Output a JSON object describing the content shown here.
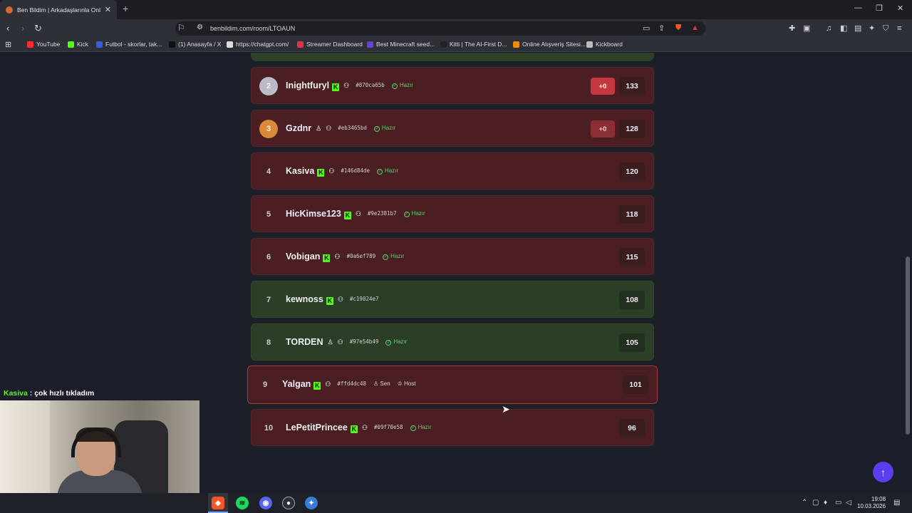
{
  "browser": {
    "tab_title": "Ben Bildim | Arkadaşlarınla Online",
    "tab_close": "✕",
    "new_tab": "+",
    "url": "benbildim.com/room/LTOAUN",
    "window_controls": [
      "—",
      "❐",
      "✕"
    ]
  },
  "bookmarks": [
    {
      "label": "YouTube",
      "color": "#ff2d2d"
    },
    {
      "label": "Kick",
      "color": "#53fc18"
    },
    {
      "label": "Futbol - skorlar, tak...",
      "color": "#3b5bdb"
    },
    {
      "label": "(1) Anasayfa / X",
      "color": "#111111"
    },
    {
      "label": "https://chatgpt.com/",
      "color": "#dddddd"
    },
    {
      "label": "Streamer Dashboard",
      "color": "#e0314b"
    },
    {
      "label": "Best Minecraft seed...",
      "color": "#6b3fd6"
    },
    {
      "label": "Kitti | The AI-First D...",
      "color": "#222222"
    },
    {
      "label": "Online Alışveriş Sitesi...",
      "color": "#f08c00"
    },
    {
      "label": "Kickboard",
      "color": "#bbbbbb"
    }
  ],
  "leaderboard": {
    "ready_label": "Hazır",
    "you_label": "Sen",
    "host_label": "Host",
    "players": [
      {
        "rank": "2",
        "name": "Inightfuryl",
        "kick": true,
        "id": "#870ca65b",
        "ready": true,
        "delta": "+0",
        "score": "133",
        "row": "red"
      },
      {
        "rank": "3",
        "name": "Gzdnr",
        "kick": false,
        "id": "#eb3465bd",
        "ready": true,
        "delta": "+0",
        "score": "128",
        "row": "red"
      },
      {
        "rank": "4",
        "name": "Kasiva",
        "kick": true,
        "id": "#146d84de",
        "ready": true,
        "delta": "",
        "score": "120",
        "row": "red"
      },
      {
        "rank": "5",
        "name": "HicKimse123",
        "kick": true,
        "id": "#9e2381b7",
        "ready": true,
        "delta": "",
        "score": "118",
        "row": "red"
      },
      {
        "rank": "6",
        "name": "Vobigan",
        "kick": true,
        "id": "#0a6ef789",
        "ready": true,
        "delta": "",
        "score": "115",
        "row": "red"
      },
      {
        "rank": "7",
        "name": "kewnoss",
        "kick": true,
        "id": "#c19024e7",
        "ready": false,
        "delta": "",
        "score": "108",
        "row": "green"
      },
      {
        "rank": "8",
        "name": "TORDEN",
        "kick": false,
        "id": "#97e54b49",
        "ready": true,
        "delta": "",
        "score": "105",
        "row": "green"
      },
      {
        "rank": "9",
        "name": "Yalgan",
        "kick": true,
        "id": "#ffd4dc48",
        "ready": false,
        "delta": "",
        "score": "101",
        "row": "me"
      },
      {
        "rank": "10",
        "name": "LePetitPrincee",
        "kick": true,
        "id": "#09f70e58",
        "ready": true,
        "delta": "",
        "score": "96",
        "row": "red"
      }
    ]
  },
  "chat_overlay": {
    "user": "Kasiva",
    "separator": " : ",
    "message": "çok hızlı tıkladım"
  },
  "scroll_top_icon": "↑",
  "taskbar": {
    "time": "19:08",
    "date": "10.03.2026"
  },
  "colors": {
    "kick_green": "#53fc18",
    "ready_green": "#56d36b",
    "accent": "#5b3ef0"
  }
}
